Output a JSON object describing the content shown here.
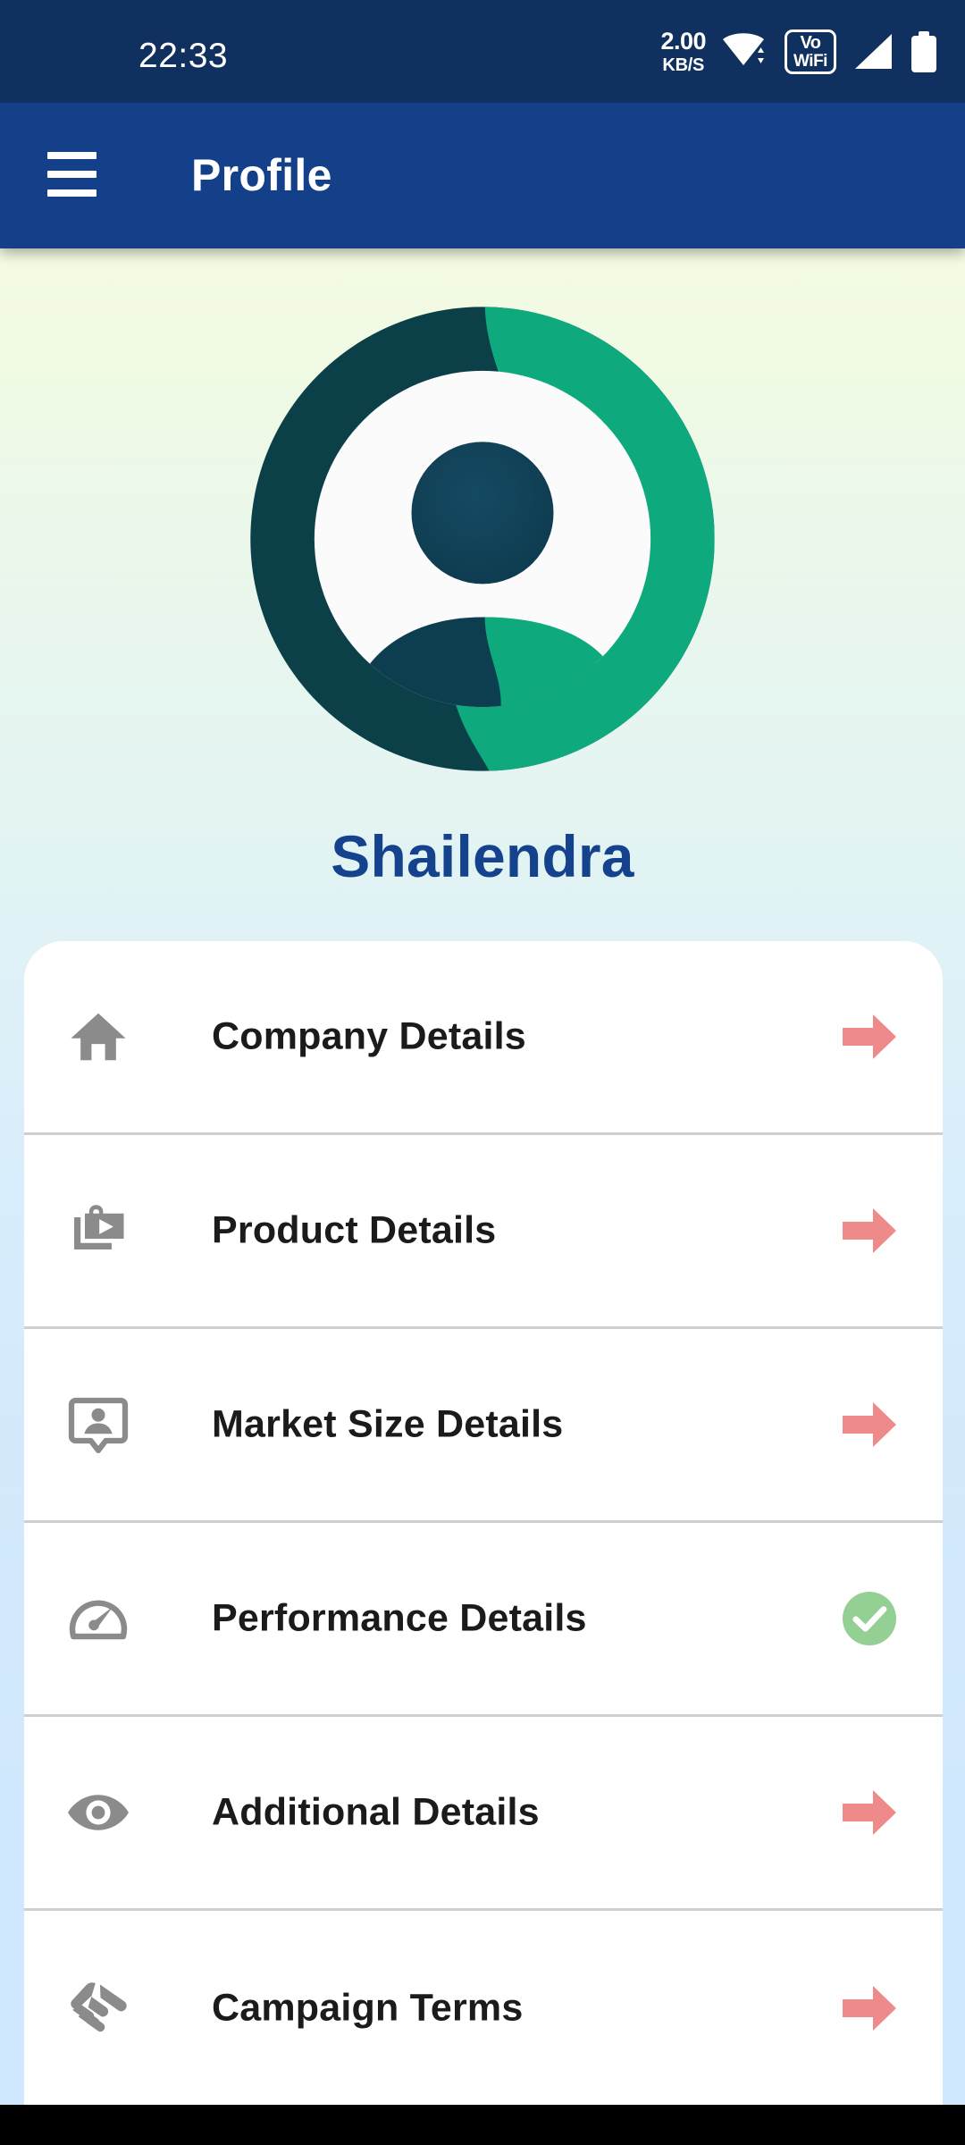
{
  "status_bar": {
    "time": "22:33",
    "net_speed_value": "2.00",
    "net_speed_unit": "KB/S",
    "wifi_icon": "wifi-icon",
    "vowifi_line1": "Vo",
    "vowifi_line2": "WiFi",
    "signal_icon": "cellular-signal-icon",
    "battery_icon": "battery-full-icon",
    "background_color": "#10305f"
  },
  "app_bar": {
    "menu_icon": "hamburger-menu-icon",
    "title": "Profile",
    "background_color": "#134088",
    "text_color": "#ffffff"
  },
  "profile": {
    "avatar_icon": "user-avatar-logo",
    "avatar_dark_color": "#0c4049",
    "avatar_green_color": "#0fa97e",
    "name": "Shailendra",
    "name_color": "#14428d"
  },
  "menu": {
    "arrow_color": "#ef8a8a",
    "check_color": "#94cf94",
    "items": [
      {
        "label": "Company Details",
        "icon": "home-icon",
        "trailing": "arrow-right-icon"
      },
      {
        "label": "Product Details",
        "icon": "product-bag-play-icon",
        "trailing": "arrow-right-icon"
      },
      {
        "label": "Market Size Details",
        "icon": "contact-card-icon",
        "trailing": "arrow-right-icon"
      },
      {
        "label": "Performance Details",
        "icon": "speedometer-icon",
        "trailing": "check-circle-icon"
      },
      {
        "label": "Additional Details",
        "icon": "eye-icon",
        "trailing": "arrow-right-icon"
      },
      {
        "label": "Campaign Terms",
        "icon": "handshake-icon",
        "trailing": "arrow-right-icon"
      }
    ]
  },
  "navigation_bar": {
    "background_color": "#000000"
  }
}
